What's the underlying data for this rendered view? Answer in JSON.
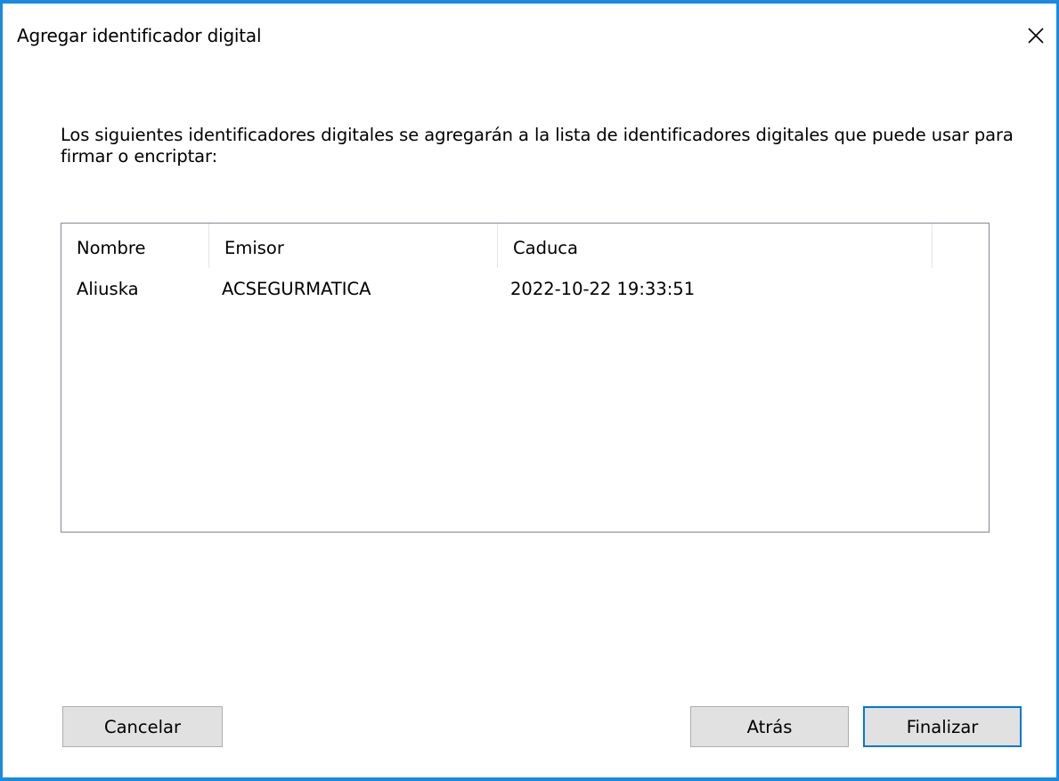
{
  "window": {
    "title": "Agregar identificador digital",
    "close_label": "×"
  },
  "intro_text": "Los siguientes identificadores digitales se agregarán a la lista de identificadores digitales que puede usar para firmar o encriptar:",
  "table": {
    "columns": [
      "Nombre",
      "Emisor",
      "Caduca"
    ],
    "rows": [
      {
        "name": "Aliuska",
        "issuer": "ACSEGURMATICA",
        "expires": "2022-10-22 19:33:51"
      }
    ]
  },
  "buttons": {
    "cancel": "Cancelar",
    "back": "Atrás",
    "finish": "Finalizar"
  },
  "colors": {
    "accent": "#0078d7",
    "window_border": "#1a8ae0",
    "button_bg": "#e1e1e1"
  }
}
